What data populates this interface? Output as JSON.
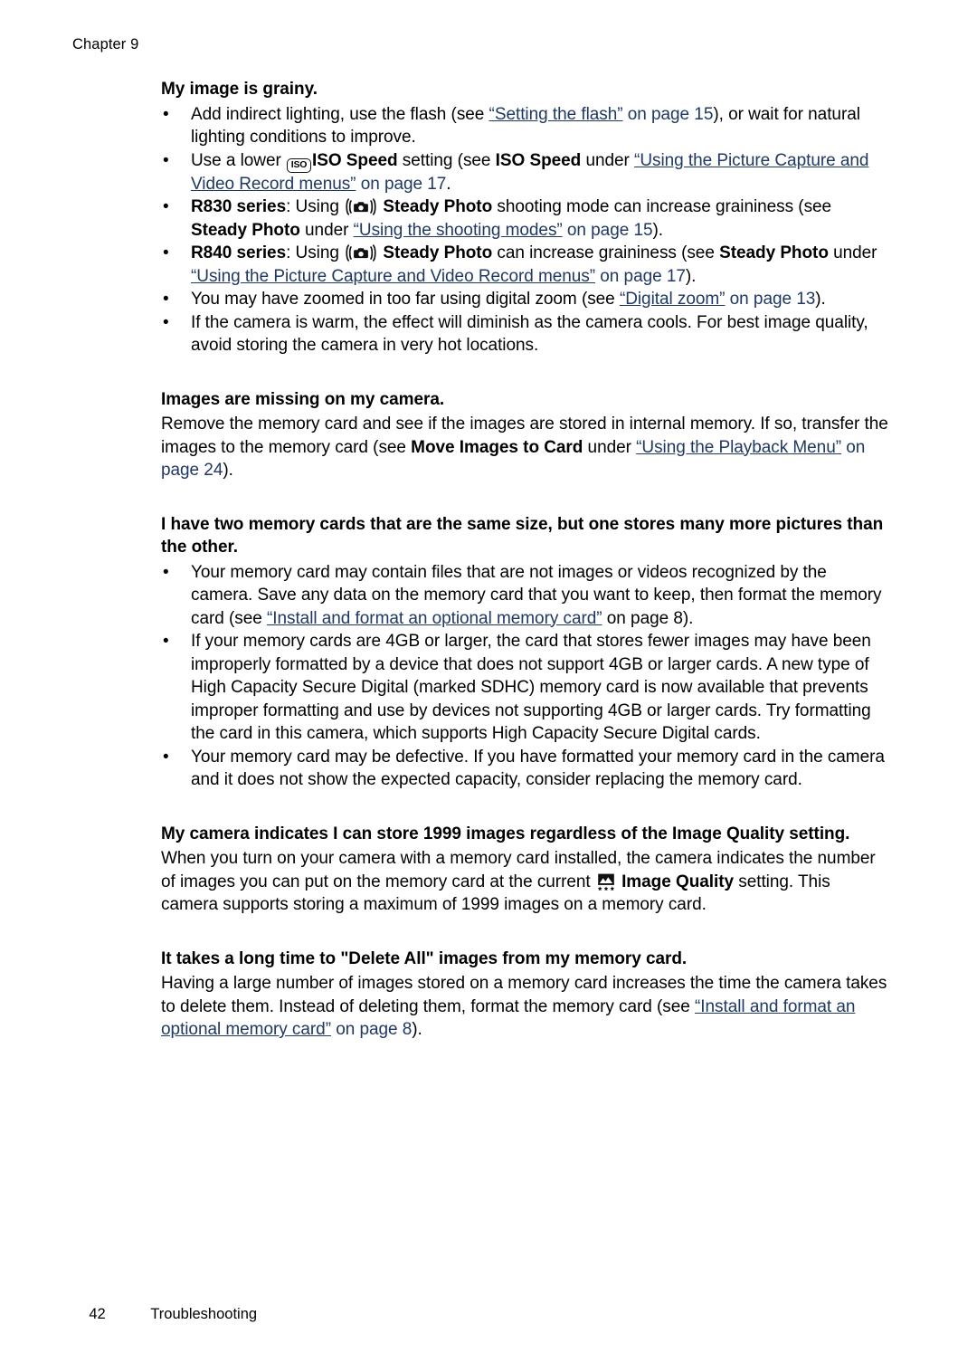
{
  "page": {
    "chapter_label": "Chapter 9",
    "footer_page_number": "42",
    "footer_section": "Troubleshooting",
    "link_color": "#1F3864",
    "text_color": "#000000",
    "background_color": "#FFFFFF"
  },
  "icons": {
    "iso_badge_label": "ISO",
    "steady_photo_icon_name": "steady-photo-icon",
    "image_quality_icon_name": "image-quality-icon"
  },
  "sections": [
    {
      "heading": "My image is grainy.",
      "bullets": [
        {
          "parts": [
            {
              "t": "text",
              "v": "Add indirect lighting, use the flash (see "
            },
            {
              "t": "link",
              "v": "“Setting the flash”"
            },
            {
              "t": "link_plain",
              "v": " on page 15"
            },
            {
              "t": "text",
              "v": "), or wait for natural lighting conditions to improve."
            }
          ]
        },
        {
          "parts": [
            {
              "t": "text",
              "v": "Use a lower "
            },
            {
              "t": "icon",
              "v": "iso"
            },
            {
              "t": "bold",
              "v": "ISO Speed"
            },
            {
              "t": "text",
              "v": " setting (see "
            },
            {
              "t": "bold",
              "v": "ISO Speed"
            },
            {
              "t": "text",
              "v": " under "
            },
            {
              "t": "link",
              "v": "“Using the Picture Capture and Video Record menus”"
            },
            {
              "t": "link_plain",
              "v": " on page 17"
            },
            {
              "t": "text",
              "v": "."
            }
          ]
        },
        {
          "parts": [
            {
              "t": "bold",
              "v": "R830 series"
            },
            {
              "t": "text",
              "v": ": Using "
            },
            {
              "t": "icon",
              "v": "steady"
            },
            {
              "t": "bold",
              "v": " Steady Photo"
            },
            {
              "t": "text",
              "v": " shooting mode can increase graininess (see "
            },
            {
              "t": "bold",
              "v": "Steady Photo"
            },
            {
              "t": "text",
              "v": " under "
            },
            {
              "t": "link",
              "v": "“Using the shooting modes”"
            },
            {
              "t": "link_plain",
              "v": " on page 15"
            },
            {
              "t": "text",
              "v": ")."
            }
          ]
        },
        {
          "parts": [
            {
              "t": "bold",
              "v": "R840 series"
            },
            {
              "t": "text",
              "v": ": Using "
            },
            {
              "t": "icon",
              "v": "steady"
            },
            {
              "t": "bold",
              "v": " Steady Photo"
            },
            {
              "t": "text",
              "v": " can increase graininess (see "
            },
            {
              "t": "bold",
              "v": "Steady Photo"
            },
            {
              "t": "text",
              "v": " under "
            },
            {
              "t": "link",
              "v": "“Using the Picture Capture and Video Record menus”"
            },
            {
              "t": "link_plain",
              "v": " on page 17"
            },
            {
              "t": "text",
              "v": ")."
            }
          ]
        },
        {
          "parts": [
            {
              "t": "text",
              "v": "You may have zoomed in too far using digital zoom (see "
            },
            {
              "t": "link",
              "v": "“Digital zoom”"
            },
            {
              "t": "link_plain",
              "v": " on page 13"
            },
            {
              "t": "text",
              "v": ")."
            }
          ]
        },
        {
          "parts": [
            {
              "t": "text",
              "v": "If the camera is warm, the effect will diminish as the camera cools. For best image quality, avoid storing the camera in very hot locations."
            }
          ]
        }
      ]
    },
    {
      "heading": "Images are missing on my camera.",
      "paragraphs": [
        {
          "parts": [
            {
              "t": "text",
              "v": "Remove the memory card and see if the images are stored in internal memory. If so, transfer the images to the memory card (see "
            },
            {
              "t": "bold",
              "v": "Move Images to Card"
            },
            {
              "t": "text",
              "v": " under "
            },
            {
              "t": "link",
              "v": "“Using the Playback Menu”"
            },
            {
              "t": "link_plain",
              "v": " on page 24"
            },
            {
              "t": "text",
              "v": ")."
            }
          ]
        }
      ]
    },
    {
      "heading": "I have two memory cards that are the same size, but one stores many more pictures than the other.",
      "bullets": [
        {
          "parts": [
            {
              "t": "text",
              "v": "Your memory card may contain files that are not images or videos recognized by the camera. Save any data on the memory card that you want to keep, then format the memory card (see "
            },
            {
              "t": "link",
              "v": "“Install and format an optional memory card”"
            },
            {
              "t": "text",
              "v": " on page 8)."
            }
          ]
        },
        {
          "parts": [
            {
              "t": "text",
              "v": "If your memory cards are 4GB or larger, the card that stores fewer images may have been improperly formatted by a device that does not support 4GB or larger cards. A new type of High Capacity Secure Digital (marked SDHC) memory card is now available that prevents improper formatting and use by devices not supporting 4GB or larger cards. Try formatting the card in this camera, which supports High Capacity Secure Digital cards."
            }
          ]
        },
        {
          "parts": [
            {
              "t": "text",
              "v": "Your memory card may be defective. If you have formatted your memory card in the camera and it does not show the expected capacity, consider replacing the memory card."
            }
          ]
        }
      ]
    },
    {
      "heading": "My camera indicates I can store 1999 images regardless of the Image Quality setting.",
      "paragraphs": [
        {
          "parts": [
            {
              "t": "text",
              "v": "When you turn on your camera with a memory card installed, the camera indicates the number of images you can put on the memory card at the current "
            },
            {
              "t": "icon",
              "v": "imgq"
            },
            {
              "t": "bold",
              "v": " Image Quality"
            },
            {
              "t": "text",
              "v": " setting. This camera supports storing a maximum of 1999 images on a memory card."
            }
          ]
        }
      ]
    },
    {
      "heading": "It takes a long time to \"Delete All\" images from my memory card.",
      "paragraphs": [
        {
          "parts": [
            {
              "t": "text",
              "v": "Having a large number of images stored on a memory card increases the time the camera takes to delete them. Instead of deleting them, format the memory card (see "
            },
            {
              "t": "link",
              "v": "“Install and format an optional memory card”"
            },
            {
              "t": "link_plain",
              "v": " on page 8"
            },
            {
              "t": "text",
              "v": ")."
            }
          ]
        }
      ]
    }
  ]
}
